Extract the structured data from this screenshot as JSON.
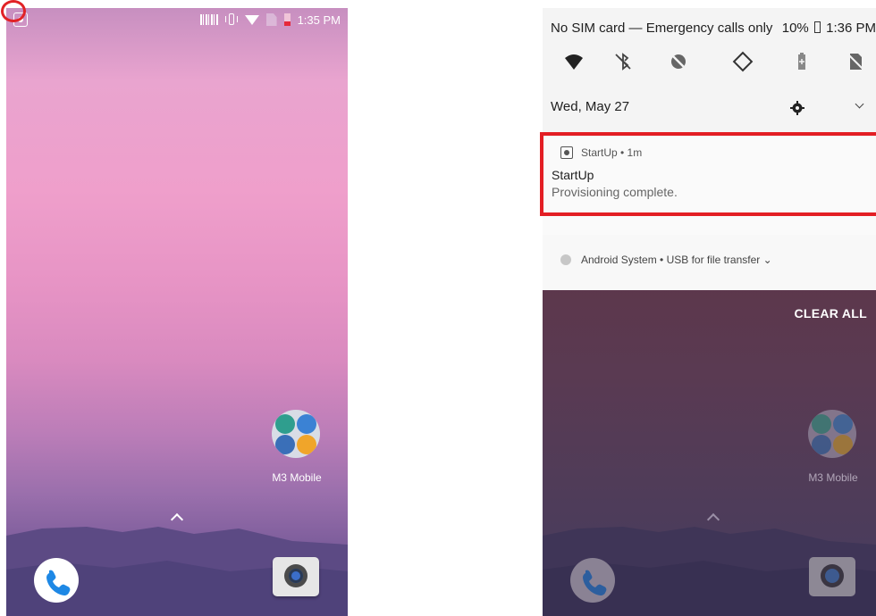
{
  "left_screen": {
    "status_bar": {
      "time": "1:35 PM"
    },
    "home": {
      "folder_label": "M3 Mobile",
      "icons": [
        "startup-notification-icon",
        "barcode-icon",
        "vibrate-icon",
        "wifi-icon",
        "no-sim-icon",
        "battery-icon",
        "folder-icon",
        "chevron-up-icon",
        "phone-icon",
        "camera-icon"
      ]
    }
  },
  "right_screen": {
    "status_bar": {
      "carrier": "No SIM card — Emergency calls only",
      "battery": "10%",
      "time": "1:36 PM"
    },
    "quick_settings": {
      "date": "Wed, May 27",
      "tiles": [
        "wifi-icon",
        "bluetooth-off-icon",
        "data-saver-icon",
        "auto-rotate-icon",
        "battery-saver-icon",
        "no-sim-icon"
      ]
    },
    "notification": {
      "app": "StartUp • 1m",
      "title": "StartUp",
      "text": "Provisioning complete."
    },
    "system_notification": {
      "text": "Android System • USB for file transfer ⌄"
    },
    "clear_all": "CLEAR ALL",
    "home": {
      "folder_label": "M3 Mobile"
    }
  },
  "colors": {
    "highlight": "#e31e24",
    "wallpaper_pink": "#ef9fcb",
    "shade_bg": "#f4f4f4"
  }
}
